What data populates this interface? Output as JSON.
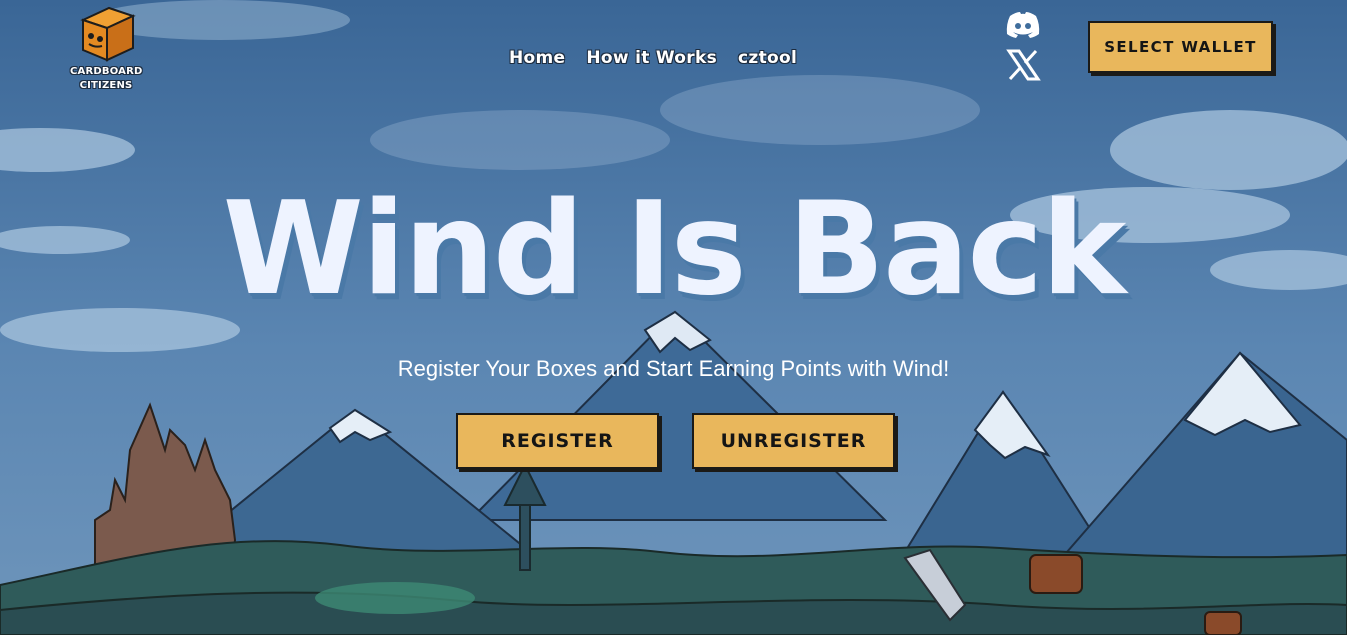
{
  "brand": {
    "line1": "CARDBOARD",
    "line2": "CITIZENS"
  },
  "nav": {
    "items": [
      "Home",
      "How it Works",
      "cztool"
    ]
  },
  "social": {
    "discord_icon": "discord-icon",
    "x_icon": "x-twitter-icon"
  },
  "wallet": {
    "label": "SELECT WALLET"
  },
  "hero": {
    "title": "Wind Is Back",
    "subtitle": "Register Your Boxes and Start Earning Points with Wind!",
    "register_label": "REGISTER",
    "unregister_label": "UNREGISTER"
  },
  "colors": {
    "sky": "#3f6d9c",
    "button": "#e9b75c",
    "button_border": "#1b1a17",
    "title_fill": "#eef3ff",
    "title_shadow": "#4a79a7"
  }
}
